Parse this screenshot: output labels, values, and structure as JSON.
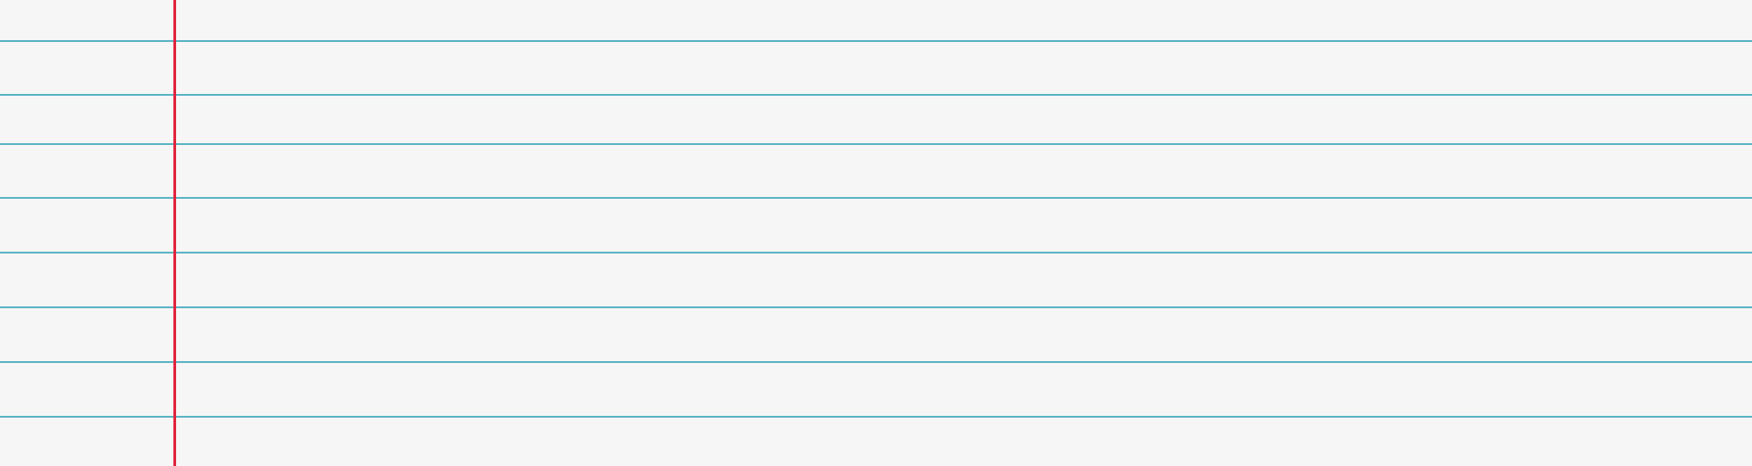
{
  "paper": {
    "style": "ruled notebook paper",
    "background_color": "#f6f6f6",
    "rule_color": "#5ab4c4",
    "margin_color": "#e0263d",
    "rule_count": 8
  }
}
